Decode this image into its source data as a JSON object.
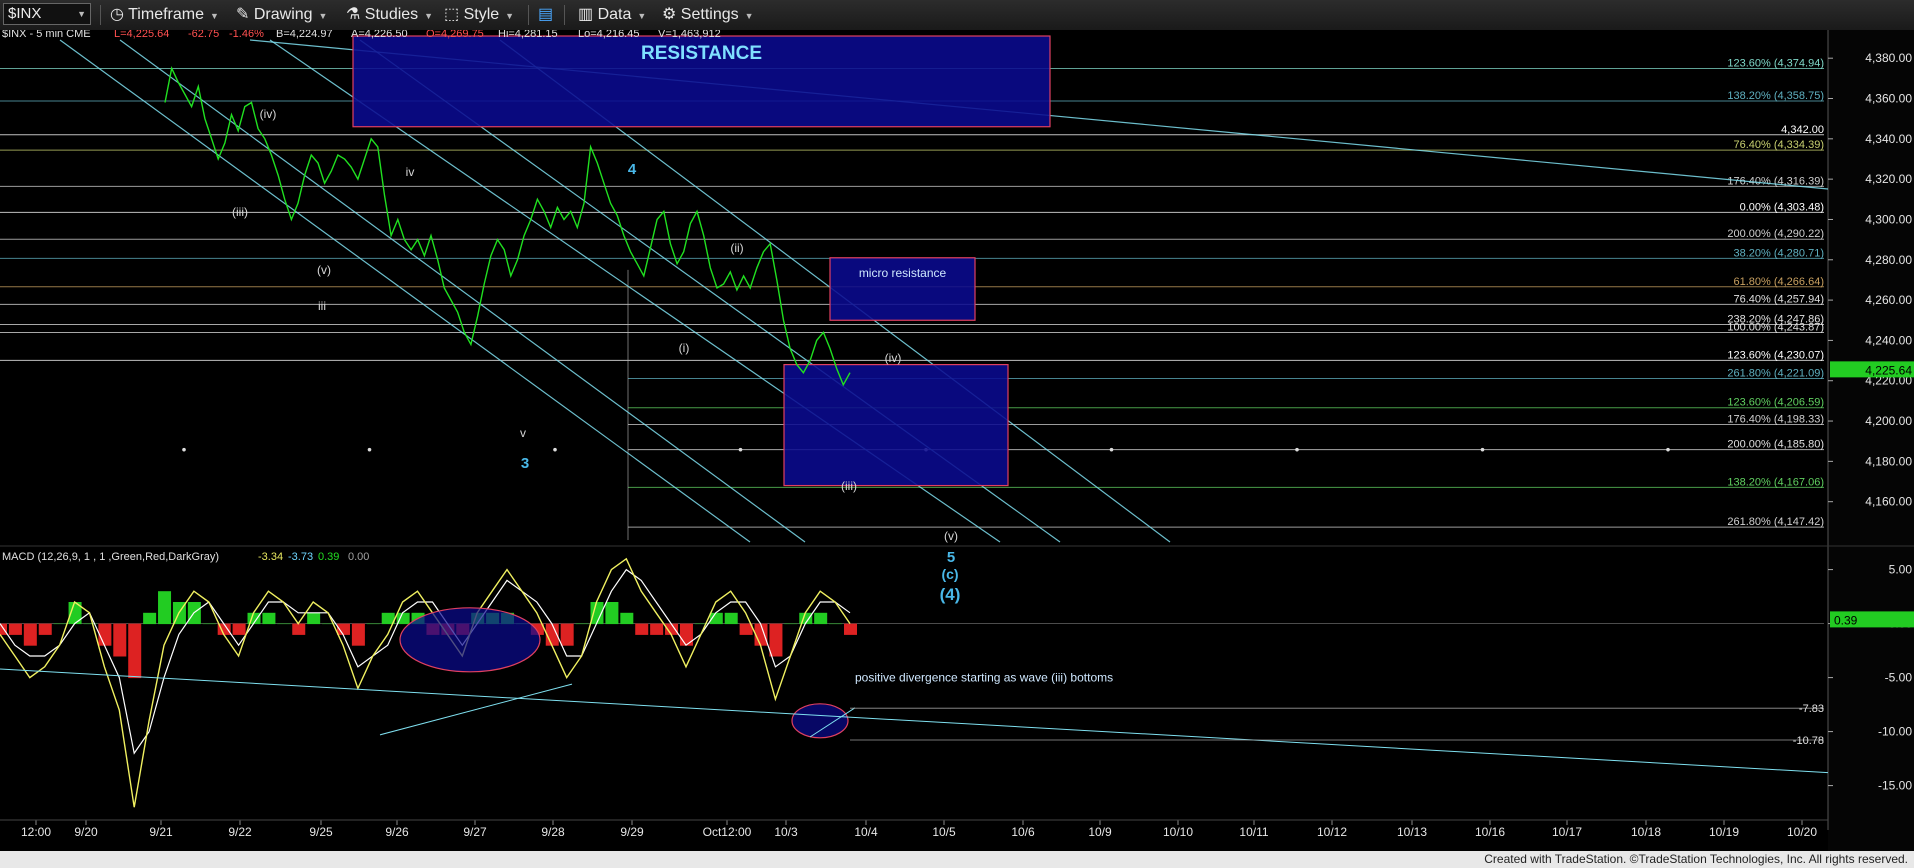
{
  "toolbar": {
    "symbol": "$INX",
    "timeframe": "Timeframe",
    "drawing": "Drawing",
    "studies": "Studies",
    "style": "Style",
    "data": "Data",
    "settings": "Settings"
  },
  "header": {
    "instrument": "$INX - 5 min  CME",
    "last": "L=4,225.64",
    "change": "-62.75",
    "change_pct": "-1.46%",
    "bid": "B=4,224.97",
    "ask": "A=4,226.50",
    "open": "O=4,269.75",
    "high": "Hi=4,281.15",
    "low": "Lo=4,216.45",
    "volume": "V=1,463,912"
  },
  "colors": {
    "price": "#20e020",
    "channel": "#7fe0f0",
    "box_fill": "#0a0a90",
    "box_border": "#e04060",
    "wave_label": "#49b8e8",
    "last_price_bg": "#22cc22",
    "macd_hist_pos": "#22cc22",
    "macd_hist_neg": "#dd2222",
    "macd_line": "#f0f060",
    "signal_line": "#ffffff"
  },
  "chart_data": [
    {
      "type": "line",
      "title": "$INX - 5 min",
      "ylim": [
        4140,
        4392
      ],
      "y_ticks": [
        "4,380.00",
        "4,360.00",
        "4,340.00",
        "4,320.00",
        "4,300.00",
        "4,280.00",
        "4,260.00",
        "4,240.00",
        "4,220.00",
        "4,200.00",
        "4,180.00",
        "4,160.00"
      ],
      "x_ticks": [
        "12:00",
        "9/20",
        "9/21",
        "9/22",
        "9/25",
        "9/26",
        "9/27",
        "9/28",
        "9/29",
        "Oct12:00",
        "10/3",
        "10/4",
        "10/5",
        "10/6",
        "10/9",
        "10/10",
        "10/11",
        "10/12",
        "10/13",
        "10/16",
        "10/17",
        "10/18",
        "10/19",
        "10/20"
      ],
      "last_price_label": "4,225.64",
      "series": [
        {
          "values": [
            4358,
            4375,
            4368,
            4362,
            4356,
            4366,
            4350,
            4340,
            4330,
            4338,
            4352,
            4344,
            4356,
            4358,
            4345,
            4340,
            4332,
            4322,
            4310,
            4300,
            4308,
            4322,
            4332,
            4328,
            4318,
            4324,
            4332,
            4330,
            4326,
            4320,
            4330,
            4340,
            4336,
            4312,
            4292,
            4300,
            4290,
            4285,
            4290,
            4282,
            4292,
            4280,
            4266,
            4260,
            4254,
            4244,
            4238,
            4252,
            4268,
            4282,
            4290,
            4285,
            4272,
            4280,
            4292,
            4300,
            4310,
            4304,
            4296,
            4306,
            4300,
            4304,
            4296,
            4308,
            4336,
            4328,
            4318,
            4308,
            4302,
            4292,
            4284,
            4278,
            4272,
            4286,
            4300,
            4304,
            4288,
            4278,
            4284,
            4298,
            4304,
            4292,
            4276,
            4266,
            4268,
            4274,
            4265,
            4272,
            4266,
            4276,
            4284,
            4288,
            4270,
            4250,
            4236,
            4228,
            4224,
            4230,
            4240,
            4244,
            4236,
            4226,
            4218,
            4224
          ]
        }
      ],
      "zones": [
        {
          "label": "RESISTANCE",
          "y_top": 4391,
          "y_bottom": 4346
        },
        {
          "label": "micro resistance",
          "y_top": 4281,
          "y_bottom": 4250
        },
        {
          "label": "",
          "y_top": 4228,
          "y_bottom": 4168
        }
      ],
      "horizontal_levels": [
        {
          "label": "123.60% (4,374.94)",
          "value": 4374.9
        },
        {
          "label": "138.20% (4,358.75)",
          "value": 4358.75
        },
        {
          "label": "4,342.00",
          "value": 4342
        },
        {
          "label": "76.40% (4,334.39)",
          "value": 4334.4
        },
        {
          "label": "176.40% (4,316.39)",
          "value": 4316.4
        },
        {
          "label": "0.00% (4,303.48)",
          "value": 4303.5
        },
        {
          "label": "200.00% (4,290.22)",
          "value": 4290.2
        },
        {
          "label": "38.20% (4,280.71)",
          "value": 4280.7
        },
        {
          "label": "61.80% (4,266.64)",
          "value": 4266.6
        },
        {
          "label": "76.40% (4,257.94)",
          "value": 4257.9
        },
        {
          "label": "238.20% (4,247.86)",
          "value": 4247.9
        },
        {
          "label": "100.00% (4,243.87)",
          "value": 4243.9
        },
        {
          "label": "123.60% (4,230.07)",
          "value": 4230.1
        },
        {
          "label": "261.80% (4,221.09)",
          "value": 4221.1
        },
        {
          "label": "123.60% (4,206.59)",
          "value": 4206.6
        },
        {
          "label": "176.40% (4,198.33)",
          "value": 4198.3
        },
        {
          "label": "200.00% (4,185.80)",
          "value": 4185.8
        },
        {
          "label": "138.20% (4,167.06)",
          "value": 4167.1
        },
        {
          "label": "261.80% (4,147.42)",
          "value": 4147.4
        }
      ],
      "wave_labels": [
        "(iv)",
        "(iii)",
        "(v)",
        "iii",
        "iv",
        "v",
        "3",
        "4",
        "(ii)",
        "(i)",
        "(iv)",
        "(iii)",
        "(v)",
        "5",
        "(c)",
        "(4)"
      ]
    },
    {
      "type": "line",
      "title": "MACD (12,26,9, 1 , 1 ,Green,Red,DarkGray)",
      "readouts": [
        "-3.34",
        "-3.73",
        "0.39",
        "0.00"
      ],
      "ylim": [
        -18,
        7
      ],
      "y_ticks": [
        "5.00",
        "0.00",
        "-5.00",
        "-10.00",
        "-15.00"
      ],
      "levels": [
        "-7.83",
        "-10.78"
      ],
      "last_value_label": "0.39",
      "annotation": "positive divergence starting as wave (iii) bottoms",
      "series": [
        {
          "values": [
            -1,
            -3,
            -5,
            -4,
            -2,
            2,
            1,
            -4,
            -8,
            -17,
            -9,
            -2,
            1,
            3,
            2,
            -1,
            -3,
            1,
            3,
            2,
            0,
            2,
            1,
            -2,
            -6,
            -3,
            -1,
            2,
            3,
            1,
            -1,
            -3,
            1,
            3,
            5,
            3,
            1,
            -2,
            -5,
            -3,
            2,
            5,
            6,
            3,
            1,
            -1,
            -4,
            -1,
            2,
            3,
            1,
            -2,
            -7,
            -3,
            1,
            3,
            2,
            0
          ]
        },
        {
          "values": [
            0,
            -2,
            -3,
            -3,
            -2,
            0,
            1,
            -2,
            -5,
            -12,
            -10,
            -5,
            -1,
            1,
            2,
            0,
            -2,
            0,
            2,
            2,
            1,
            1,
            1,
            -1,
            -4,
            -3,
            -2,
            1,
            2,
            2,
            0,
            -2,
            0,
            2,
            4,
            3,
            2,
            0,
            -3,
            -3,
            0,
            3,
            5,
            4,
            2,
            0,
            -2,
            -1,
            1,
            2,
            2,
            0,
            -4,
            -3,
            0,
            2,
            2,
            1
          ]
        }
      ]
    }
  ],
  "footer": {
    "credit": "Created with TradeStation. ©TradeStation Technologies, Inc. All rights reserved."
  }
}
